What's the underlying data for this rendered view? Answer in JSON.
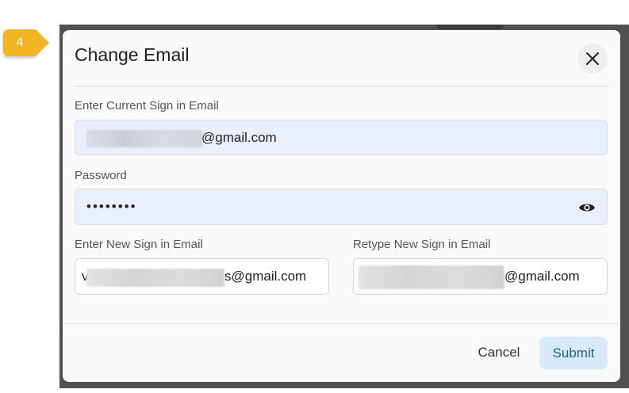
{
  "step_badge": {
    "number": "4",
    "color": "#f4b525"
  },
  "dialog": {
    "title": "Change Email",
    "close_icon": "close-icon"
  },
  "form": {
    "current_email": {
      "label": "Enter Current Sign in Email",
      "value_suffix": "@gmail.com"
    },
    "password": {
      "label": "Password",
      "value_masked": "••••••••",
      "toggle_icon": "eye-icon"
    },
    "new_email": {
      "label": "Enter New Sign in Email",
      "value_prefix": "v",
      "value_suffix": "s@gmail.com"
    },
    "retype_email": {
      "label": "Retype New Sign in Email",
      "value_suffix": "@gmail.com"
    }
  },
  "footer": {
    "cancel_label": "Cancel",
    "submit_label": "Submit"
  },
  "colors": {
    "accent": "#1d5e94",
    "submit_bg": "#d9ebfa",
    "filled_field_bg": "#e9effb"
  }
}
